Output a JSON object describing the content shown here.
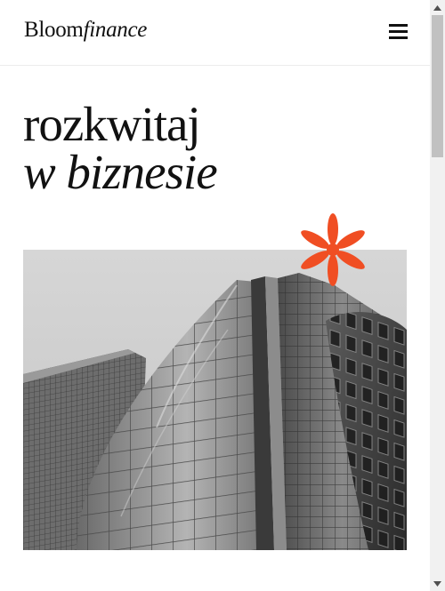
{
  "header": {
    "logo_word": "Bloom",
    "logo_italic": "finance",
    "menu_icon": "hamburger-menu-icon"
  },
  "hero": {
    "title_line1": "rozkwitaj",
    "title_line2": "w biznesie",
    "decoration_icon": "asterisk-icon",
    "image_subject": "skyscraper-photo"
  },
  "colors": {
    "accent": "#f04e23",
    "text": "#111111",
    "background": "#ffffff"
  },
  "scrollbar": {
    "position_fraction": 0.0
  }
}
